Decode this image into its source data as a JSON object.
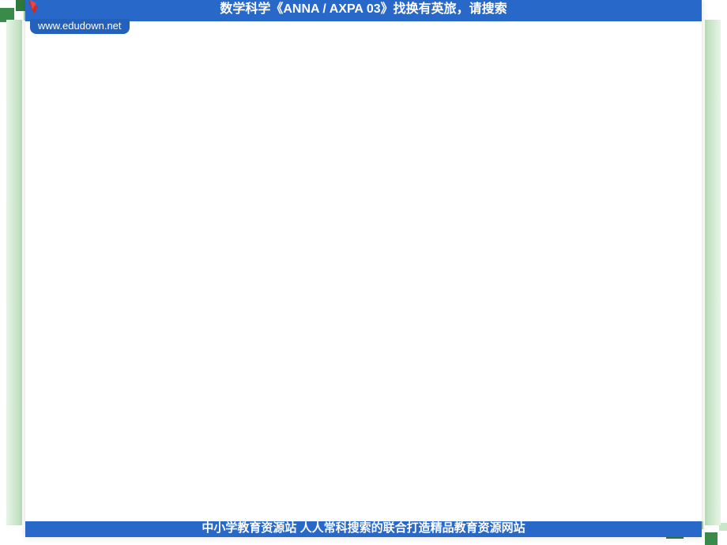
{
  "header": {
    "title_text": "数学科学《ANNA / AXPA 03》找换有英旅，请搜索",
    "url_text": "www.edudown.net"
  },
  "footer": {
    "text": "中小学教育资源站  人人常科搜索的联合打造精品教育资源网站"
  },
  "colors": {
    "primary_blue": "#2868c8",
    "secondary_blue": "#2361bd",
    "green_dark": "#2d7a3d",
    "green_light": "#a8d4a8",
    "red_accent": "#cc2929"
  }
}
